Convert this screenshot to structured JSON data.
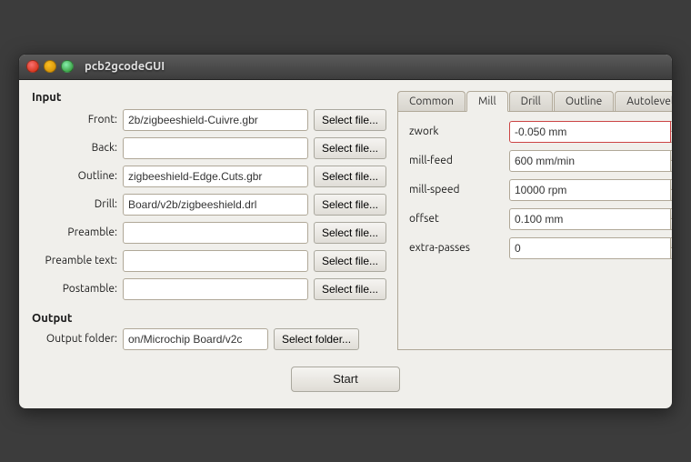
{
  "window": {
    "title": "pcb2gcodeGUI",
    "close_btn": "×",
    "minimize_btn": "–",
    "maximize_btn": "+"
  },
  "input_section": {
    "title": "Input",
    "rows": [
      {
        "label": "Front:",
        "value": "2b/zigbeeshield-Cuivre.gbr",
        "btn": "Select file..."
      },
      {
        "label": "Back:",
        "value": "",
        "btn": "Select file..."
      },
      {
        "label": "Outline:",
        "value": "zigbeeshield-Edge.Cuts.gbr",
        "btn": "Select file..."
      },
      {
        "label": "Drill:",
        "value": "Board/v2b/zigbeeshield.drl",
        "btn": "Select file..."
      },
      {
        "label": "Preamble:",
        "value": "",
        "btn": "Select file..."
      },
      {
        "label": "Preamble text:",
        "value": "",
        "btn": "Select file..."
      },
      {
        "label": "Postamble:",
        "value": "",
        "btn": "Select file..."
      }
    ]
  },
  "output_section": {
    "title": "Output",
    "label": "Output folder:",
    "value": "on/Microchip Board/v2c",
    "btn": "Select folder..."
  },
  "tabs": {
    "items": [
      {
        "id": "common",
        "label": "Common",
        "active": false
      },
      {
        "id": "mill",
        "label": "Mill",
        "active": true
      },
      {
        "id": "drill",
        "label": "Drill",
        "active": false
      },
      {
        "id": "outline",
        "label": "Outline",
        "active": false
      },
      {
        "id": "autoleveller",
        "label": "Autoleveller",
        "active": false
      }
    ]
  },
  "mill_params": {
    "rows": [
      {
        "id": "zwork",
        "label": "zwork",
        "value": "-0.050 mm",
        "highlight": true
      },
      {
        "id": "mill-feed",
        "label": "mill-feed",
        "value": "600 mm/min",
        "highlight": false
      },
      {
        "id": "mill-speed",
        "label": "mill-speed",
        "value": "10000 rpm",
        "highlight": false
      },
      {
        "id": "offset",
        "label": "offset",
        "value": "0.100 mm",
        "highlight": false
      },
      {
        "id": "extra-passes",
        "label": "extra-passes",
        "value": "0",
        "highlight": false
      }
    ]
  },
  "bottom": {
    "start_label": "Start"
  }
}
